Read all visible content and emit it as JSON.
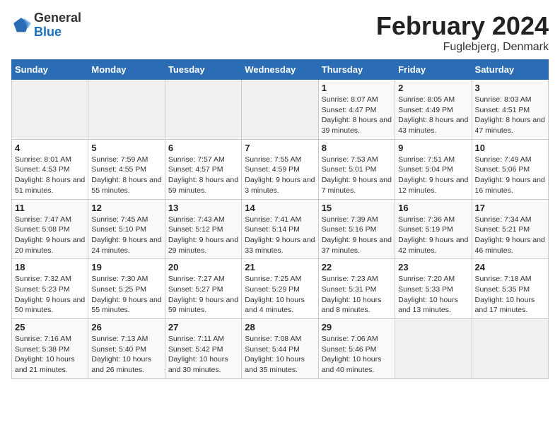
{
  "header": {
    "logo": {
      "general": "General",
      "blue": "Blue"
    },
    "title": "February 2024",
    "subtitle": "Fuglebjerg, Denmark"
  },
  "weekdays": [
    "Sunday",
    "Monday",
    "Tuesday",
    "Wednesday",
    "Thursday",
    "Friday",
    "Saturday"
  ],
  "weeks": [
    [
      {
        "day": "",
        "sunrise": "",
        "sunset": "",
        "daylight": ""
      },
      {
        "day": "",
        "sunrise": "",
        "sunset": "",
        "daylight": ""
      },
      {
        "day": "",
        "sunrise": "",
        "sunset": "",
        "daylight": ""
      },
      {
        "day": "",
        "sunrise": "",
        "sunset": "",
        "daylight": ""
      },
      {
        "day": "1",
        "sunrise": "Sunrise: 8:07 AM",
        "sunset": "Sunset: 4:47 PM",
        "daylight": "Daylight: 8 hours and 39 minutes."
      },
      {
        "day": "2",
        "sunrise": "Sunrise: 8:05 AM",
        "sunset": "Sunset: 4:49 PM",
        "daylight": "Daylight: 8 hours and 43 minutes."
      },
      {
        "day": "3",
        "sunrise": "Sunrise: 8:03 AM",
        "sunset": "Sunset: 4:51 PM",
        "daylight": "Daylight: 8 hours and 47 minutes."
      }
    ],
    [
      {
        "day": "4",
        "sunrise": "Sunrise: 8:01 AM",
        "sunset": "Sunset: 4:53 PM",
        "daylight": "Daylight: 8 hours and 51 minutes."
      },
      {
        "day": "5",
        "sunrise": "Sunrise: 7:59 AM",
        "sunset": "Sunset: 4:55 PM",
        "daylight": "Daylight: 8 hours and 55 minutes."
      },
      {
        "day": "6",
        "sunrise": "Sunrise: 7:57 AM",
        "sunset": "Sunset: 4:57 PM",
        "daylight": "Daylight: 8 hours and 59 minutes."
      },
      {
        "day": "7",
        "sunrise": "Sunrise: 7:55 AM",
        "sunset": "Sunset: 4:59 PM",
        "daylight": "Daylight: 9 hours and 3 minutes."
      },
      {
        "day": "8",
        "sunrise": "Sunrise: 7:53 AM",
        "sunset": "Sunset: 5:01 PM",
        "daylight": "Daylight: 9 hours and 7 minutes."
      },
      {
        "day": "9",
        "sunrise": "Sunrise: 7:51 AM",
        "sunset": "Sunset: 5:04 PM",
        "daylight": "Daylight: 9 hours and 12 minutes."
      },
      {
        "day": "10",
        "sunrise": "Sunrise: 7:49 AM",
        "sunset": "Sunset: 5:06 PM",
        "daylight": "Daylight: 9 hours and 16 minutes."
      }
    ],
    [
      {
        "day": "11",
        "sunrise": "Sunrise: 7:47 AM",
        "sunset": "Sunset: 5:08 PM",
        "daylight": "Daylight: 9 hours and 20 minutes."
      },
      {
        "day": "12",
        "sunrise": "Sunrise: 7:45 AM",
        "sunset": "Sunset: 5:10 PM",
        "daylight": "Daylight: 9 hours and 24 minutes."
      },
      {
        "day": "13",
        "sunrise": "Sunrise: 7:43 AM",
        "sunset": "Sunset: 5:12 PM",
        "daylight": "Daylight: 9 hours and 29 minutes."
      },
      {
        "day": "14",
        "sunrise": "Sunrise: 7:41 AM",
        "sunset": "Sunset: 5:14 PM",
        "daylight": "Daylight: 9 hours and 33 minutes."
      },
      {
        "day": "15",
        "sunrise": "Sunrise: 7:39 AM",
        "sunset": "Sunset: 5:16 PM",
        "daylight": "Daylight: 9 hours and 37 minutes."
      },
      {
        "day": "16",
        "sunrise": "Sunrise: 7:36 AM",
        "sunset": "Sunset: 5:19 PM",
        "daylight": "Daylight: 9 hours and 42 minutes."
      },
      {
        "day": "17",
        "sunrise": "Sunrise: 7:34 AM",
        "sunset": "Sunset: 5:21 PM",
        "daylight": "Daylight: 9 hours and 46 minutes."
      }
    ],
    [
      {
        "day": "18",
        "sunrise": "Sunrise: 7:32 AM",
        "sunset": "Sunset: 5:23 PM",
        "daylight": "Daylight: 9 hours and 50 minutes."
      },
      {
        "day": "19",
        "sunrise": "Sunrise: 7:30 AM",
        "sunset": "Sunset: 5:25 PM",
        "daylight": "Daylight: 9 hours and 55 minutes."
      },
      {
        "day": "20",
        "sunrise": "Sunrise: 7:27 AM",
        "sunset": "Sunset: 5:27 PM",
        "daylight": "Daylight: 9 hours and 59 minutes."
      },
      {
        "day": "21",
        "sunrise": "Sunrise: 7:25 AM",
        "sunset": "Sunset: 5:29 PM",
        "daylight": "Daylight: 10 hours and 4 minutes."
      },
      {
        "day": "22",
        "sunrise": "Sunrise: 7:23 AM",
        "sunset": "Sunset: 5:31 PM",
        "daylight": "Daylight: 10 hours and 8 minutes."
      },
      {
        "day": "23",
        "sunrise": "Sunrise: 7:20 AM",
        "sunset": "Sunset: 5:33 PM",
        "daylight": "Daylight: 10 hours and 13 minutes."
      },
      {
        "day": "24",
        "sunrise": "Sunrise: 7:18 AM",
        "sunset": "Sunset: 5:35 PM",
        "daylight": "Daylight: 10 hours and 17 minutes."
      }
    ],
    [
      {
        "day": "25",
        "sunrise": "Sunrise: 7:16 AM",
        "sunset": "Sunset: 5:38 PM",
        "daylight": "Daylight: 10 hours and 21 minutes."
      },
      {
        "day": "26",
        "sunrise": "Sunrise: 7:13 AM",
        "sunset": "Sunset: 5:40 PM",
        "daylight": "Daylight: 10 hours and 26 minutes."
      },
      {
        "day": "27",
        "sunrise": "Sunrise: 7:11 AM",
        "sunset": "Sunset: 5:42 PM",
        "daylight": "Daylight: 10 hours and 30 minutes."
      },
      {
        "day": "28",
        "sunrise": "Sunrise: 7:08 AM",
        "sunset": "Sunset: 5:44 PM",
        "daylight": "Daylight: 10 hours and 35 minutes."
      },
      {
        "day": "29",
        "sunrise": "Sunrise: 7:06 AM",
        "sunset": "Sunset: 5:46 PM",
        "daylight": "Daylight: 10 hours and 40 minutes."
      },
      {
        "day": "",
        "sunrise": "",
        "sunset": "",
        "daylight": ""
      },
      {
        "day": "",
        "sunrise": "",
        "sunset": "",
        "daylight": ""
      }
    ]
  ]
}
